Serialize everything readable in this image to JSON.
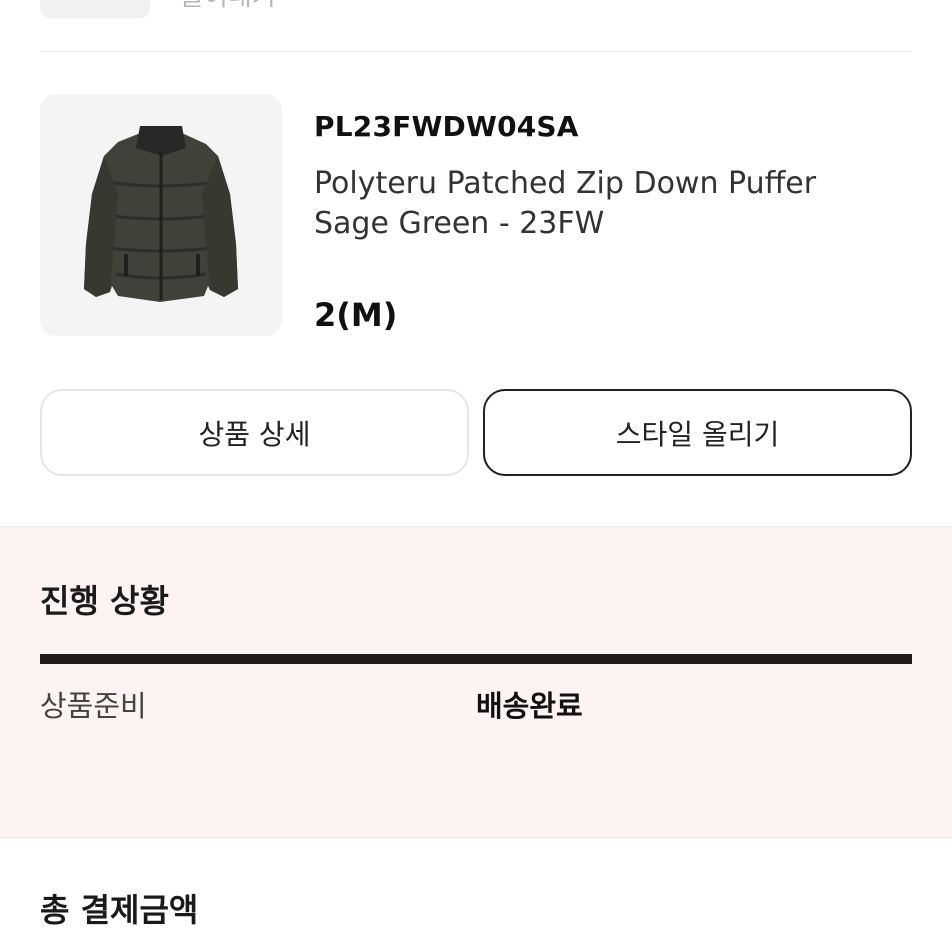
{
  "top": {
    "cut_text": "쓸어내기"
  },
  "product": {
    "code": "PL23FWDW04SA",
    "name_line1": "Polyteru Patched Zip Down Puffer",
    "name_line2": "Sage Green - 23FW",
    "size": "2(M)",
    "image_icon": "puffer-jacket-image"
  },
  "buttons": {
    "detail_label": "상품 상세",
    "style_label": "스타일 올리기"
  },
  "progress": {
    "title": "진행 상황",
    "steps": [
      "상품준비",
      "배송완료"
    ],
    "current_step": "배송완료",
    "completion": 1.0
  },
  "payment": {
    "title": "총 결제금액"
  },
  "colors": {
    "progress_bg": "#fdf3f3",
    "progress_fill": "#231a1a",
    "jacket": "#3e4238"
  }
}
